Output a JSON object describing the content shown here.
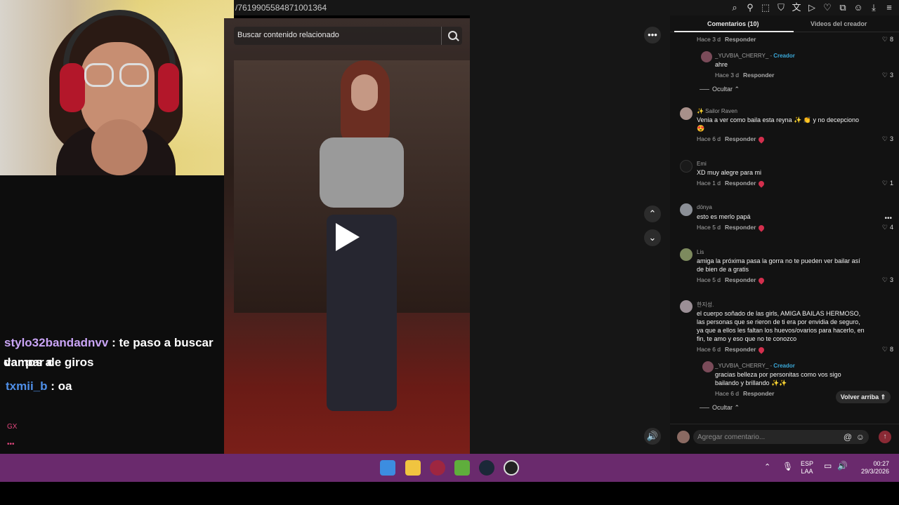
{
  "url_fragment": "/7619905584871001364",
  "video": {
    "search_placeholder": "Buscar contenido relacionado"
  },
  "chat": {
    "messages": [
      {
        "user": "stylo32bandadnvv",
        "text": ": te paso a buscar vamos a",
        "cont": "dar par de giros"
      },
      {
        "user": "txmii_b",
        "text": ": oa"
      }
    ],
    "footer_badge": "GX",
    "dots": "•••"
  },
  "panel": {
    "tab_comments": "Comentarios (10)",
    "tab_creator_videos": "Videos del creador",
    "reply_label": "Responder",
    "hide_label": "Ocultar ⌃",
    "creator_label": "Creador",
    "back_to_top": "Volver arriba ⇑",
    "comment_placeholder": "Agregar comentario...",
    "comments": [
      {
        "time": "Hace 3 d",
        "likes": "8"
      },
      {
        "author": "_YUVBIA_CHERRY_ -",
        "text": "ahre",
        "time": "Hace 3 d",
        "likes": "3"
      },
      {
        "author": "✨ Sailor Raven",
        "text": "Venia a ver como baila esta reyna ✨ 👏 y no decepciono",
        "text2": "😍",
        "time": "Hace 6 d",
        "likes": "3"
      },
      {
        "author": "Emi",
        "text": "XD muy alegre para mi",
        "time": "Hace 1 d",
        "likes": "1"
      },
      {
        "author": "dönya",
        "text": "esto es merlo papá",
        "time": "Hace 5 d",
        "likes": "4"
      },
      {
        "author": "Lis",
        "text": "amiga la próxima pasa la gorra no te pueden ver bailar así",
        "text2": "de bien de a gratis",
        "time": "Hace 5 d",
        "likes": "3"
      },
      {
        "author": "한지성.",
        "text": "el cuerpo soñado de las girls, AMIGA BAILAS HERMOSO,",
        "text2": "las personas que se rieron de ti era por envidia de seguro,",
        "text3": "ya que a ellos les faltan los huevos/ovarios para hacerlo, en",
        "text4": "fin, te amo y eso que no te conozco",
        "time": "Hace 6 d",
        "likes": "8"
      },
      {
        "author": "_YUVBIA_CHERRY_ -",
        "text": "gracias belleza por personitas como vos sigo",
        "text2": "bailando y brillando ✨✨",
        "time": "Hace 6 d"
      }
    ]
  },
  "tray": {
    "lang1": "ESP",
    "lang2": "LAA",
    "time": "00:27",
    "date": "29/3/2026"
  },
  "colors": {
    "taskbar": "#6a2a6d",
    "creator": "#3aa8d8",
    "chat_user1": "#c9a4f5",
    "chat_user2": "#4f8fe8"
  }
}
